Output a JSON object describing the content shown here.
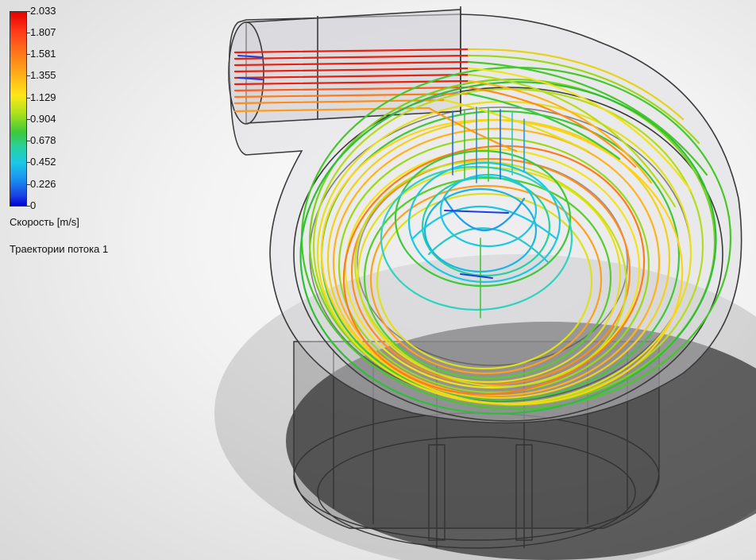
{
  "legend": {
    "ticks": [
      "2.033",
      "1.807",
      "1.581",
      "1.355",
      "1.129",
      "0.904",
      "0.678",
      "0.452",
      "0.226",
      "0"
    ],
    "title": "Скорость [m/s]",
    "plot_name": "Траектории потока 1",
    "colors": {
      "max": "#e60000",
      "high": "#ff8c1a",
      "mid_high": "#ffe619",
      "mid": "#3ec83a",
      "mid_low": "#1ac8e6",
      "low": "#1a3ee6",
      "min": "#0000d0"
    }
  },
  "scene": {
    "object": "pump-volute-flow-trajectories",
    "line_colors": [
      "#e60000",
      "#ff6a1a",
      "#ffb31a",
      "#f0e61a",
      "#a8dc1a",
      "#3ec83a",
      "#28c8c8",
      "#1ac8e6"
    ]
  }
}
